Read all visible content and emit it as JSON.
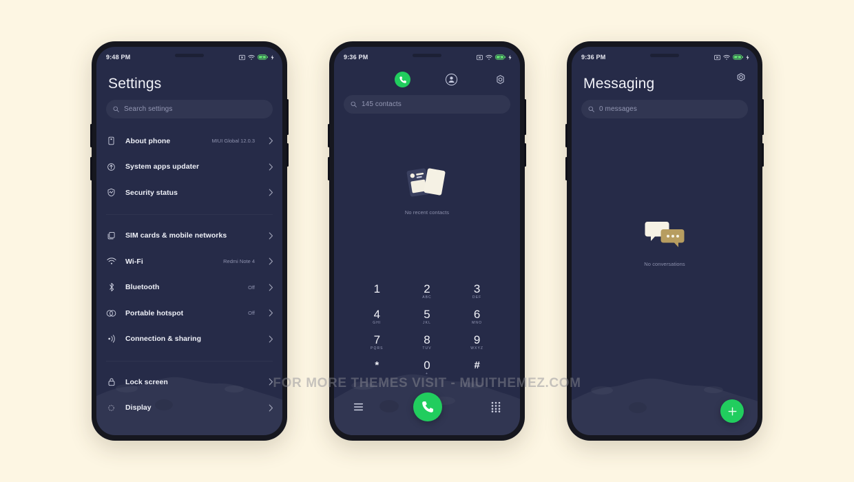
{
  "watermark": "FOR MORE THEMES VISIT - MIUITHEMEZ.COM",
  "theme": {
    "screen_bg": "#262b48",
    "accent_green": "#21cd5e",
    "page_bg": "#fdf6e3",
    "frame": "#16171f",
    "text_primary": "#eef0f7",
    "text_secondary": "#8e92ae"
  },
  "phones": [
    {
      "id": "settings",
      "statusbar": {
        "time": "9:48 PM",
        "icons": [
          "no-sim-icon",
          "wifi-icon",
          "battery-icon",
          "charging-bolt-icon"
        ]
      },
      "title": "Settings",
      "search": {
        "placeholder": "Search settings",
        "icon": "search-icon"
      },
      "rows": [
        {
          "icon": "phone-outline-icon",
          "label": "About phone",
          "value": "MIUI Global 12.0.3"
        },
        {
          "icon": "update-icon",
          "label": "System apps updater",
          "value": ""
        },
        {
          "icon": "security-shield-icon",
          "label": "Security status",
          "value": ""
        },
        {
          "divider": true
        },
        {
          "icon": "sim-card-icon",
          "label": "SIM cards & mobile networks",
          "value": ""
        },
        {
          "icon": "wifi-icon",
          "label": "Wi-Fi",
          "value": "Redmi Note 4"
        },
        {
          "icon": "bluetooth-icon",
          "label": "Bluetooth",
          "value": "Off"
        },
        {
          "icon": "hotspot-icon",
          "label": "Portable hotspot",
          "value": "Off"
        },
        {
          "icon": "connection-sharing-icon",
          "label": "Connection & sharing",
          "value": ""
        },
        {
          "divider": true
        },
        {
          "icon": "lock-icon",
          "label": "Lock screen",
          "value": ""
        },
        {
          "icon": "display-icon",
          "label": "Display",
          "value": ""
        }
      ]
    },
    {
      "id": "dialer",
      "statusbar": {
        "time": "9:36 PM",
        "icons": [
          "no-sim-icon",
          "wifi-icon",
          "battery-icon",
          "charging-bolt-icon"
        ]
      },
      "tabs": [
        {
          "name": "tab-dialer",
          "icon": "phone-icon",
          "active": true
        },
        {
          "name": "tab-contacts",
          "icon": "contacts-icon",
          "active": false
        },
        {
          "name": "tab-settings",
          "icon": "gear-icon",
          "active": false
        }
      ],
      "search": {
        "placeholder": "145 contacts",
        "icon": "search-icon"
      },
      "empty": {
        "caption": "No recent contacts",
        "illustration": "contact-cards-icon"
      },
      "keys": [
        {
          "digit": "1",
          "letters": ""
        },
        {
          "digit": "2",
          "letters": "ABC"
        },
        {
          "digit": "3",
          "letters": "DEF"
        },
        {
          "digit": "4",
          "letters": "GHI"
        },
        {
          "digit": "5",
          "letters": "JKL"
        },
        {
          "digit": "6",
          "letters": "MNO"
        },
        {
          "digit": "7",
          "letters": "PQRS"
        },
        {
          "digit": "8",
          "letters": "TUV"
        },
        {
          "digit": "9",
          "letters": "WXYZ"
        },
        {
          "digit": "*",
          "letters": ""
        },
        {
          "digit": "0",
          "letters": "+"
        },
        {
          "digit": "#",
          "letters": ""
        }
      ],
      "bottom": {
        "left_icon": "call-log-list-icon",
        "call_icon": "phone-icon",
        "right_icon": "keypad-grid-icon"
      }
    },
    {
      "id": "messaging",
      "statusbar": {
        "time": "9:36 PM",
        "icons": [
          "no-sim-icon",
          "wifi-icon",
          "battery-icon",
          "charging-bolt-icon"
        ]
      },
      "gear_icon": "gear-icon",
      "title": "Messaging",
      "search": {
        "placeholder": "0 messages",
        "icon": "search-icon"
      },
      "empty": {
        "caption": "No conversations",
        "illustration": "chat-bubbles-icon"
      },
      "fab": {
        "icon": "plus-icon"
      }
    }
  ]
}
